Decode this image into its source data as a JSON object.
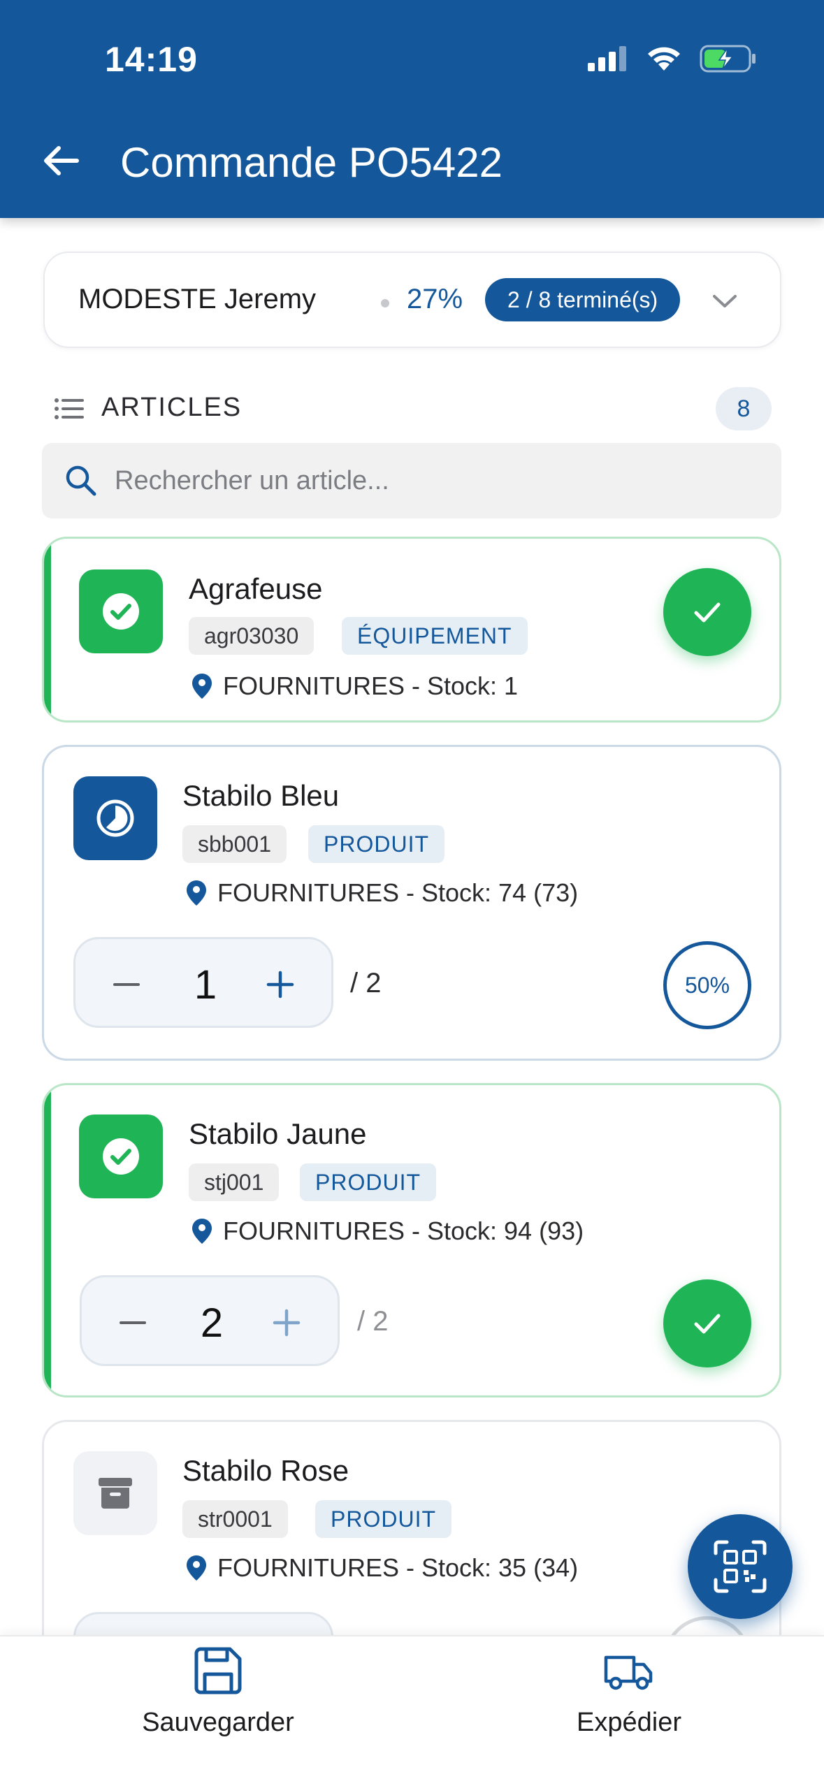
{
  "status_bar": {
    "time": "14:19"
  },
  "header": {
    "title": "Commande PO5422"
  },
  "summary": {
    "name": "MODESTE Jeremy",
    "percent": "27%",
    "finished": "2 / 8 terminé(s)"
  },
  "section": {
    "title": "ARTICLES",
    "count": "8"
  },
  "search": {
    "placeholder": "Rechercher un article..."
  },
  "articles": [
    {
      "name": "Agrafeuse",
      "ref": "agr03030",
      "category": "ÉQUIPEMENT",
      "location": "FOURNITURES - Stock: 1",
      "status": "done"
    },
    {
      "name": "Stabilo Bleu",
      "ref": "sbb001",
      "category": "PRODUIT",
      "location": "FOURNITURES - Stock: 74 (73)",
      "quantity": "1",
      "of": "/ 2",
      "progress": "50%",
      "status": "in-progress"
    },
    {
      "name": "Stabilo Jaune",
      "ref": "stj001",
      "category": "PRODUIT",
      "location": "FOURNITURES - Stock: 94 (93)",
      "quantity": "2",
      "of": "/ 2",
      "status": "done"
    },
    {
      "name": "Stabilo Rose",
      "ref": "str0001",
      "category": "PRODUIT",
      "location": "FOURNITURES - Stock: 35 (34)",
      "status": "pending"
    }
  ],
  "bottom_bar": {
    "save": "Sauvegarder",
    "ship": "Expédier"
  },
  "icons": [
    "back-arrow-icon",
    "signal-icon",
    "wifi-icon",
    "battery-charging-icon",
    "chevron-down-icon",
    "list-icon",
    "search-icon",
    "check-circle-icon",
    "clock-icon",
    "archive-box-icon",
    "location-pin-icon",
    "minus-icon",
    "plus-icon",
    "checkmark-icon",
    "qr-scan-icon",
    "floppy-disk-icon",
    "truck-icon"
  ],
  "colors": {
    "primary": "#14579a",
    "success": "#1fb455",
    "primary_border": "#cbd8e6",
    "success_border": "#b9e6c6"
  }
}
